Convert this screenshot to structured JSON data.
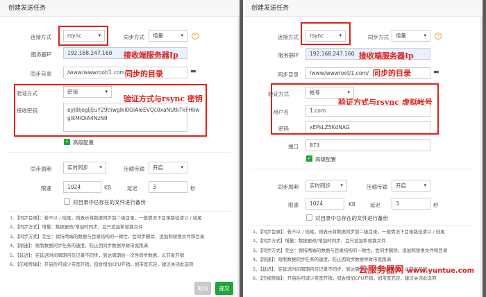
{
  "left": {
    "title": "创建发送任务",
    "labels": {
      "connection": "连接方式",
      "sync_mode": "同步方式",
      "server_ip": "服务器IP",
      "sync_dir": "同步目录",
      "auth": "验证方式",
      "recv_key": "接收密钥",
      "period": "同步周期",
      "compress": "压缩传输",
      "limit": "限速",
      "delay": "延迟"
    },
    "values": {
      "connection": "rsync",
      "sync_mode": "增量",
      "server_ip": "192.168.247.160",
      "sync_dir": "/www/wwwroot/1.com/",
      "auth": "密钥",
      "recv_key_line1": "eyJ8IjogIjEuY29tIiwgIkl0OiAieEVQc0xaNUtkTkFHIiw",
      "recv_key_line2": "gIkMiOiA4NzN9",
      "period": "实时同步",
      "compress": "开启",
      "limit": "1024",
      "delay": "3"
    },
    "units": {
      "kb": "KB",
      "sec": "秒"
    },
    "advanced": "高级配置",
    "backup": "对目录中已存在的文件进行备份",
    "annotations": {
      "server": "接收端服务器Ip",
      "dir": "同步的目录",
      "auth": "验证方式与rsync 密钥"
    },
    "notes": [
      "1、【同步目录】：若不以 / 结尾，则表示将数据同步到二级目录，一般情况下目录路径请以 / 结尾",
      "2、【同步方式】增量：数据更改/增加时同步，且只追加和替换文件",
      "3、【同步方式】完全：保持两端的数据与目录结构的一致性，会同步删除、追加和替换文件和目录",
      "4、【限速】：限制数据同步任务的速度，防止因同步数据导致带宽跑满",
      "5、【延迟】：在延迟时间周期内仅记录不同步，到达周期后一次性同步数据，以节省开销",
      "6、【压缩传输】：开启后可减少带宽开销，但会增加CPU开销，如带宽充足，建议关闭此选项"
    ],
    "buttons": {
      "cancel": "取消",
      "submit": "提交"
    }
  },
  "right": {
    "title": "创建发送任务",
    "labels": {
      "connection": "连接方式",
      "sync_mode": "同步方式",
      "server_ip": "服务器IP",
      "sync_dir": "同步目录",
      "auth": "验证方式",
      "user": "用户名",
      "password": "密码",
      "port": "端口",
      "period": "同步周期",
      "compress": "压缩传输",
      "limit": "限速",
      "delay": "延迟"
    },
    "values": {
      "connection": "rsync",
      "sync_mode": "增量",
      "server_ip": "192.168.247.160",
      "sync_dir": "/www/wwwroot/1.com/",
      "auth": "帐号",
      "user": "1.com",
      "password": "xEPsLZ5KdNAG",
      "port": "873",
      "period": "实时同步",
      "compress": "开启",
      "limit": "1024",
      "delay": "3"
    },
    "units": {
      "kb": "KB",
      "sec": "秒"
    },
    "advanced": "高级配置",
    "backup": "对目录中已存在的文件进行备份",
    "annotations": {
      "server": "接收端服务器Ip",
      "dir": "同步的目录",
      "auth": "验证方式与rsync 虚拟帐号"
    },
    "notes": [
      "1、【同步目录】：若不以 / 结尾，则表示将数据同步到二级目录，一般情况下目录路径请以 / 结尾",
      "2、【同步方式】增量：数据更改/增加时同步，且只追加和替换文件",
      "3、【同步方式】完全：保持两端的数据与目录结构的一致性，会同步删除、追加和替换文件和目录",
      "4、【限速】：限制数据同步任务的速度，防止因同步数据导致带宽跑满",
      "5、【延迟】：在延迟时间周期内仅记录不同步，到达周期后一次性同步数据，以节省开销",
      "6、【压缩传输】：开启后可减少带宽开销，但会增加CPU开销，如带宽充足，建议关闭此选项"
    ],
    "watermark": {
      "text": "云服务器网",
      "url": "www.yuntue.com"
    }
  }
}
